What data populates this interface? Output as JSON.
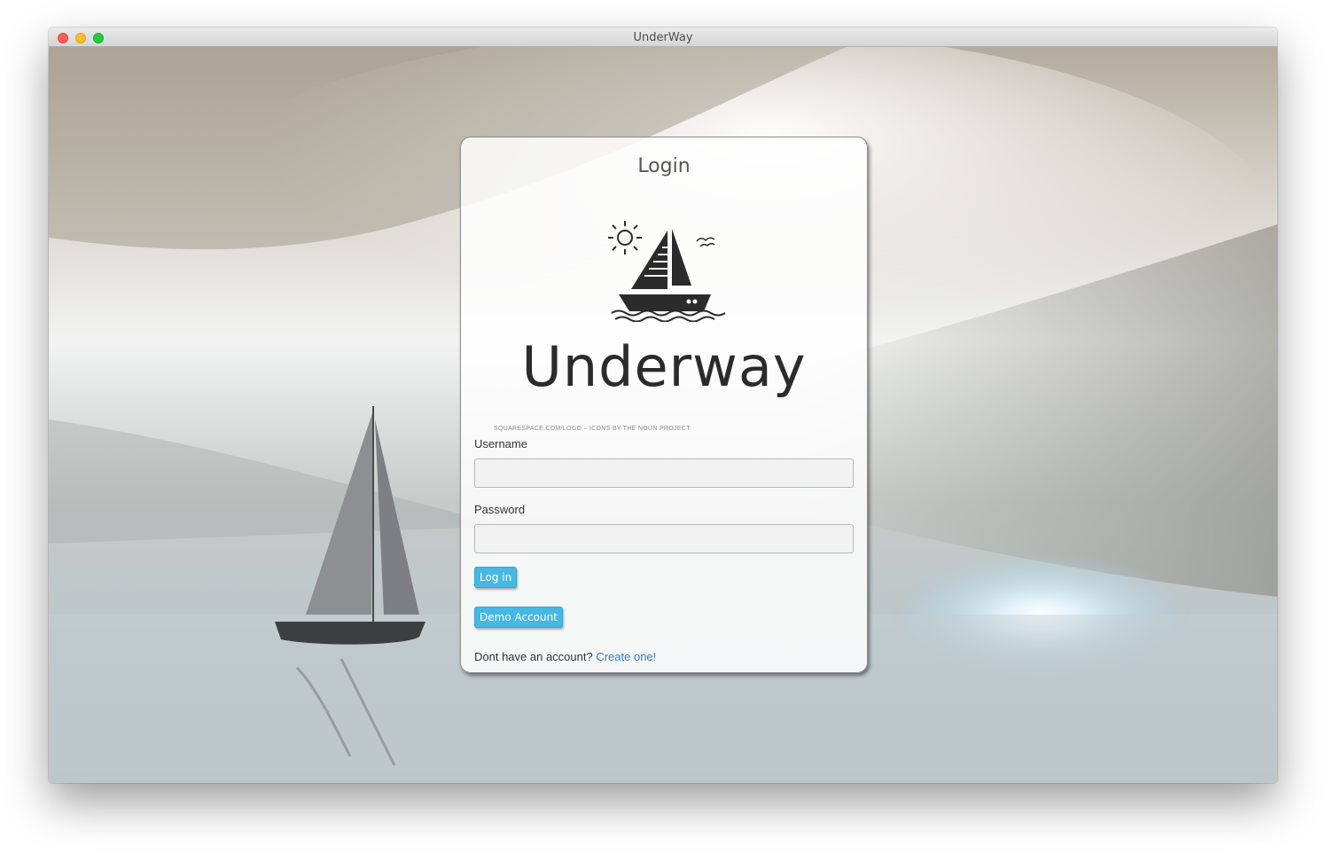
{
  "window": {
    "title": "UnderWay"
  },
  "login": {
    "heading": "Login",
    "brand": "Underway",
    "credit": "SQUARESPACE.COM/LOGO – ICONS BY THE NOUN PROJECT",
    "username_label": "Username",
    "username_value": "",
    "password_label": "Password",
    "password_value": "",
    "login_button": "Log in",
    "demo_button": "Demo Account",
    "signup_prompt": "Dont have an account?",
    "signup_link": "Create one!"
  },
  "icons": {
    "logo": "sailboat-logo-icon",
    "sun": "sun-icon",
    "birds": "birds-icon",
    "window_controls": [
      "close-icon",
      "minimize-icon",
      "maximize-icon"
    ]
  },
  "colors": {
    "accent": "#45b8e3",
    "link": "#2a7fc1",
    "close": "#fe5f57",
    "minimize": "#febc2e",
    "maximize": "#28c840"
  }
}
